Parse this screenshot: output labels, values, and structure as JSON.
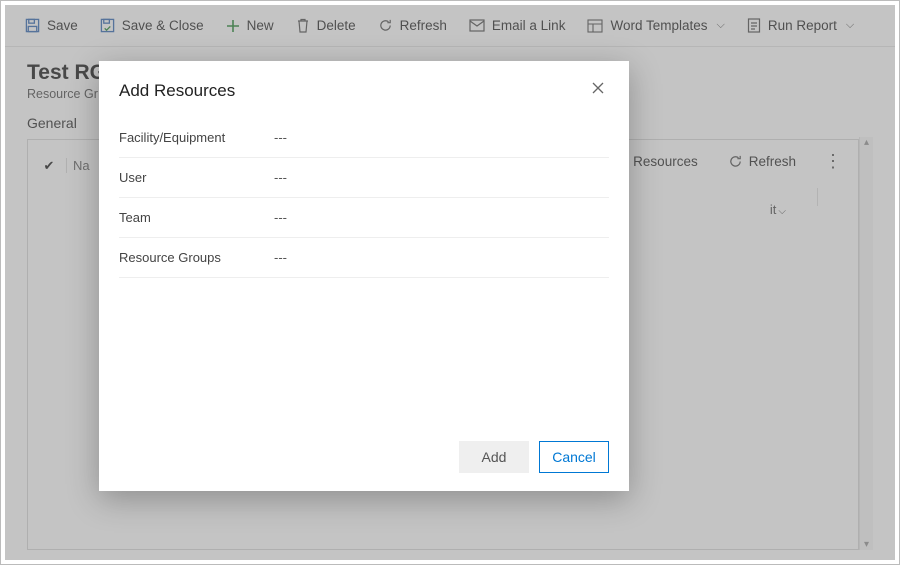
{
  "commandBar": {
    "save": "Save",
    "saveClose": "Save & Close",
    "new": "New",
    "delete": "Delete",
    "refresh": "Refresh",
    "emailLink": "Email a Link",
    "wordTemplates": "Word Templates",
    "runReport": "Run Report"
  },
  "page": {
    "title": "Test RG",
    "subtitle": "Resource Gr",
    "tab": "General",
    "gridNameCol": "Na",
    "buCell": "it",
    "addResources": "Add Resources",
    "refresh": "Refresh"
  },
  "modal": {
    "title": "Add Resources",
    "fields": [
      {
        "label": "Facility/Equipment",
        "value": "---"
      },
      {
        "label": "User",
        "value": "---"
      },
      {
        "label": "Team",
        "value": "---"
      },
      {
        "label": "Resource Groups",
        "value": "---"
      }
    ],
    "addBtn": "Add",
    "cancelBtn": "Cancel"
  }
}
